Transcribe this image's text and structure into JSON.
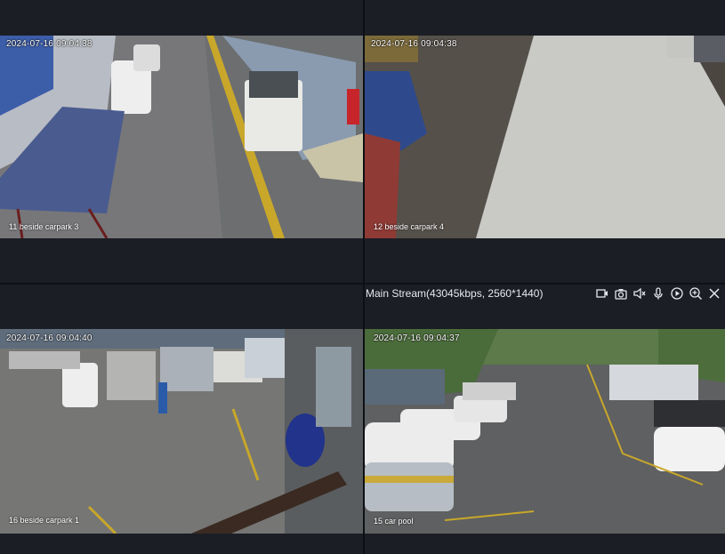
{
  "cameras": [
    {
      "timestamp": "2024-07-16 09:04:38",
      "label": "11  beside carpark 3"
    },
    {
      "timestamp": "2024-07-16 09:04:38",
      "label": "12  beside carpark 4"
    },
    {
      "timestamp": "2024-07-16 09:04:40",
      "label": "16  beside carpark 1"
    },
    {
      "timestamp": "2024-07-16 09:04:37",
      "label": "15  car pool"
    }
  ],
  "stream": {
    "info": "Main Stream(43045kbps, 2560*1440)"
  },
  "toolbar_icons": [
    "record-clip-icon",
    "snapshot-icon",
    "volume-icon",
    "microphone-icon",
    "playback-icon",
    "zoom-in-icon",
    "close-icon"
  ]
}
